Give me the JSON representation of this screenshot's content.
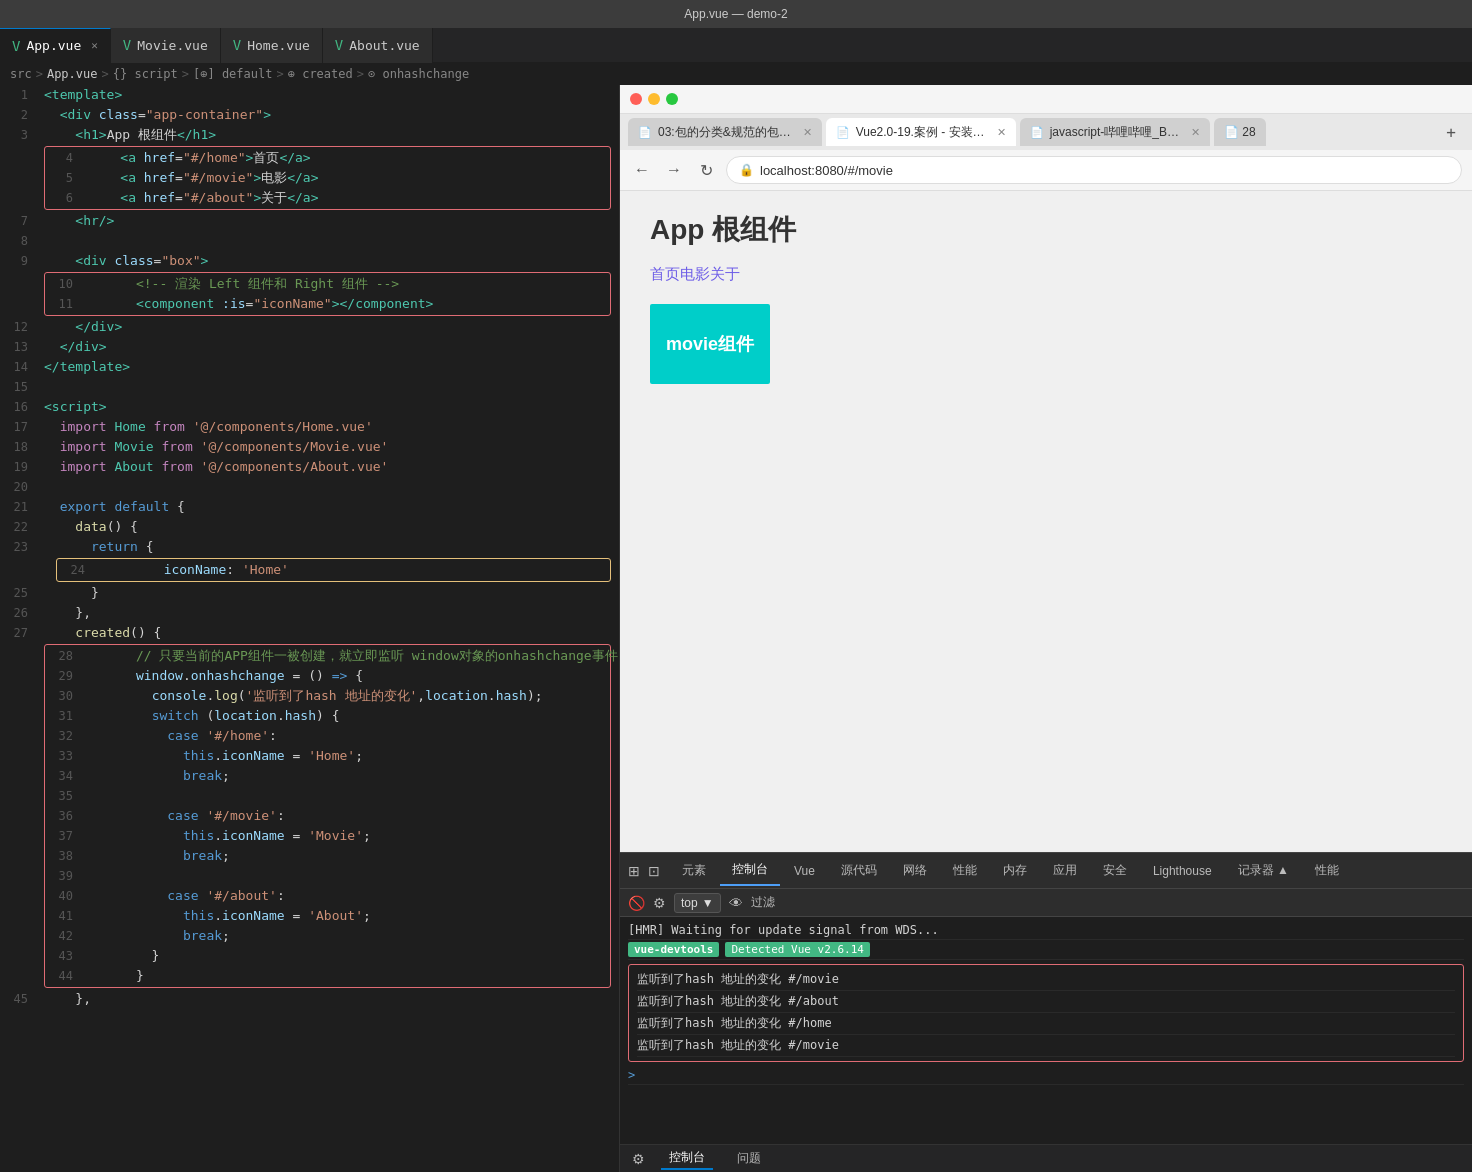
{
  "titleBar": {
    "text": "App.vue — demo-2"
  },
  "editorTabs": [
    {
      "id": "app-vue",
      "label": "App.vue",
      "active": true,
      "icon": "V"
    },
    {
      "id": "movie-vue",
      "label": "Movie.vue",
      "active": false,
      "icon": "V"
    },
    {
      "id": "home-vue",
      "label": "Home.vue",
      "active": false,
      "icon": "V"
    },
    {
      "id": "about-vue",
      "label": "About.vue",
      "active": false,
      "icon": "V"
    }
  ],
  "breadcrumb": {
    "parts": [
      "src",
      ">",
      "App.vue",
      ">",
      "{} script",
      ">",
      "[⊕] default",
      ">",
      "⊕ created",
      ">",
      "⊙ onhashchange"
    ]
  },
  "browserTabs": [
    {
      "id": "tab1",
      "label": "03:包的分类&规范的包…",
      "active": false,
      "icon": "📄"
    },
    {
      "id": "tab2",
      "label": "Vue2.0-19.案例 - 安装…",
      "active": true,
      "icon": "📄"
    },
    {
      "id": "tab3",
      "label": "javascript-哔哩哔哩_B…",
      "active": false,
      "icon": "📄"
    },
    {
      "id": "tab4",
      "label": "28",
      "active": false,
      "icon": "📄"
    }
  ],
  "addressBar": {
    "url": "localhost:8080/#/movie"
  },
  "browserPage": {
    "title": "App 根组件",
    "navLinks": [
      "首页",
      "电影",
      "关于"
    ],
    "movieComponent": "movie组件"
  },
  "devtools": {
    "tabs": [
      "元素",
      "控制台",
      "Vue",
      "源代码",
      "网络",
      "性能",
      "内存",
      "应用",
      "安全",
      "Lighthouse",
      "记录器 ▲",
      "性能"
    ],
    "activeTab": "控制台",
    "consoleTop": "top",
    "consoleFilter": "过滤",
    "consoleLines": [
      "[HMR] Waiting for update signal from WDS...",
      "vue-devtools Detected Vue v2.6.14",
      "监听到了hash 地址的变化 #/movie",
      "监听到了hash 地址的变化 #/about",
      "监听到了hash 地址的变化 #/home",
      "监听到了hash 地址的变化 #/movie"
    ]
  },
  "bottomBar": {
    "tabs": [
      "控制台",
      "问题"
    ]
  },
  "codeLines": [
    {
      "num": 1,
      "content": "<template>"
    },
    {
      "num": 2,
      "content": "  <div class=\"app-container\">"
    },
    {
      "num": 3,
      "content": "    <h1>App 根组件</h1>"
    },
    {
      "num": 4,
      "content": "    <a href=\"#/home\">首页</a>"
    },
    {
      "num": 5,
      "content": "    <a href=\"#/movie\">电影</a>"
    },
    {
      "num": 6,
      "content": "    <a href=\"#/about\">关于</a>"
    },
    {
      "num": 7,
      "content": "    <hr/>"
    },
    {
      "num": 8,
      "content": ""
    },
    {
      "num": 9,
      "content": "    <div class=\"box\">"
    },
    {
      "num": 10,
      "content": "      <!-- 渲染 Left 组件和 Right 组件 -->"
    },
    {
      "num": 11,
      "content": "      <component :is=\"iconName\"></component>"
    },
    {
      "num": 12,
      "content": "    </div>"
    },
    {
      "num": 13,
      "content": "  </div>"
    },
    {
      "num": 14,
      "content": "</template>"
    },
    {
      "num": 15,
      "content": ""
    },
    {
      "num": 16,
      "content": "<script>"
    },
    {
      "num": 17,
      "content": "  import Home from '@/components/Home.vue'"
    },
    {
      "num": 18,
      "content": "  import Movie from '@/components/Movie.vue'"
    },
    {
      "num": 19,
      "content": "  import About from '@/components/About.vue'"
    },
    {
      "num": 20,
      "content": ""
    },
    {
      "num": 21,
      "content": "  export default {"
    },
    {
      "num": 22,
      "content": "    data() {"
    },
    {
      "num": 23,
      "content": "      return {"
    },
    {
      "num": 24,
      "content": "        iconName: 'Home'"
    },
    {
      "num": 25,
      "content": "      }"
    },
    {
      "num": 26,
      "content": "    },"
    },
    {
      "num": 27,
      "content": "    created() {"
    },
    {
      "num": 28,
      "content": "      // 只要当前的APP组件一被创建，就立即监听 window对象的onhashchange事件"
    },
    {
      "num": 29,
      "content": "      window.onhashchange = () => {"
    },
    {
      "num": 30,
      "content": "        console.log('监听到了hash 地址的变化', location.hash);"
    },
    {
      "num": 31,
      "content": "        switch (location.hash) {"
    },
    {
      "num": 32,
      "content": "          case '#/home':"
    },
    {
      "num": 33,
      "content": "            this.iconName = 'Home';"
    },
    {
      "num": 34,
      "content": "            break;"
    },
    {
      "num": 35,
      "content": ""
    },
    {
      "num": 36,
      "content": "          case '#/movie':"
    },
    {
      "num": 37,
      "content": "            this.iconName = 'Movie';"
    },
    {
      "num": 38,
      "content": "            break;"
    },
    {
      "num": 39,
      "content": ""
    },
    {
      "num": 40,
      "content": "          case '#/about':"
    },
    {
      "num": 41,
      "content": "            this.iconName = 'About';"
    },
    {
      "num": 42,
      "content": "            break;"
    },
    {
      "num": 43,
      "content": "        }"
    },
    {
      "num": 44,
      "content": "      }"
    },
    {
      "num": 45,
      "content": "    },"
    }
  ]
}
